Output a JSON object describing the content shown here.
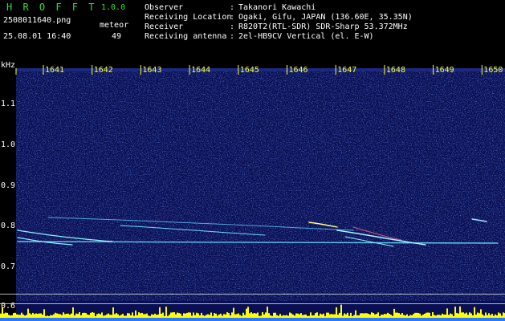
{
  "header": {
    "app_name": "H R O F F T",
    "app_version": "1.0.0",
    "filename": "2508011640.png",
    "datetime": "25.08.01 16:40",
    "count_label": "meteor",
    "count_value": "49",
    "fields": [
      {
        "label": "Observer",
        "value": "Takanori Kawachi"
      },
      {
        "label": "Receiving Location",
        "value": "Ogaki, Gifu, JAPAN (136.60E, 35.35N)"
      },
      {
        "label": "Receiver",
        "value": "R820T2(RTL-SDR) SDR-Sharp 53.372MHz"
      },
      {
        "label": "Receiving antenna",
        "value": "2el-HB9CV Vertical (el. E-W)"
      }
    ],
    "separator": ":"
  },
  "spectrogram": {
    "unit_label": "kHz",
    "freq_ticks": [
      "1.1",
      "1.0",
      "0.9",
      "0.8",
      "0.7",
      "0.6"
    ],
    "time_ticks": [
      "1641",
      "1642",
      "1643",
      "1644",
      "1645",
      "1646",
      "1647",
      "1648",
      "1649",
      "1650"
    ],
    "colors": {
      "background": "#0a0f52",
      "trace": "#7fe0ff",
      "tick_labels": "#ffff33",
      "level_bars": "#ffff00",
      "level_base": "#2a78ff"
    }
  }
}
